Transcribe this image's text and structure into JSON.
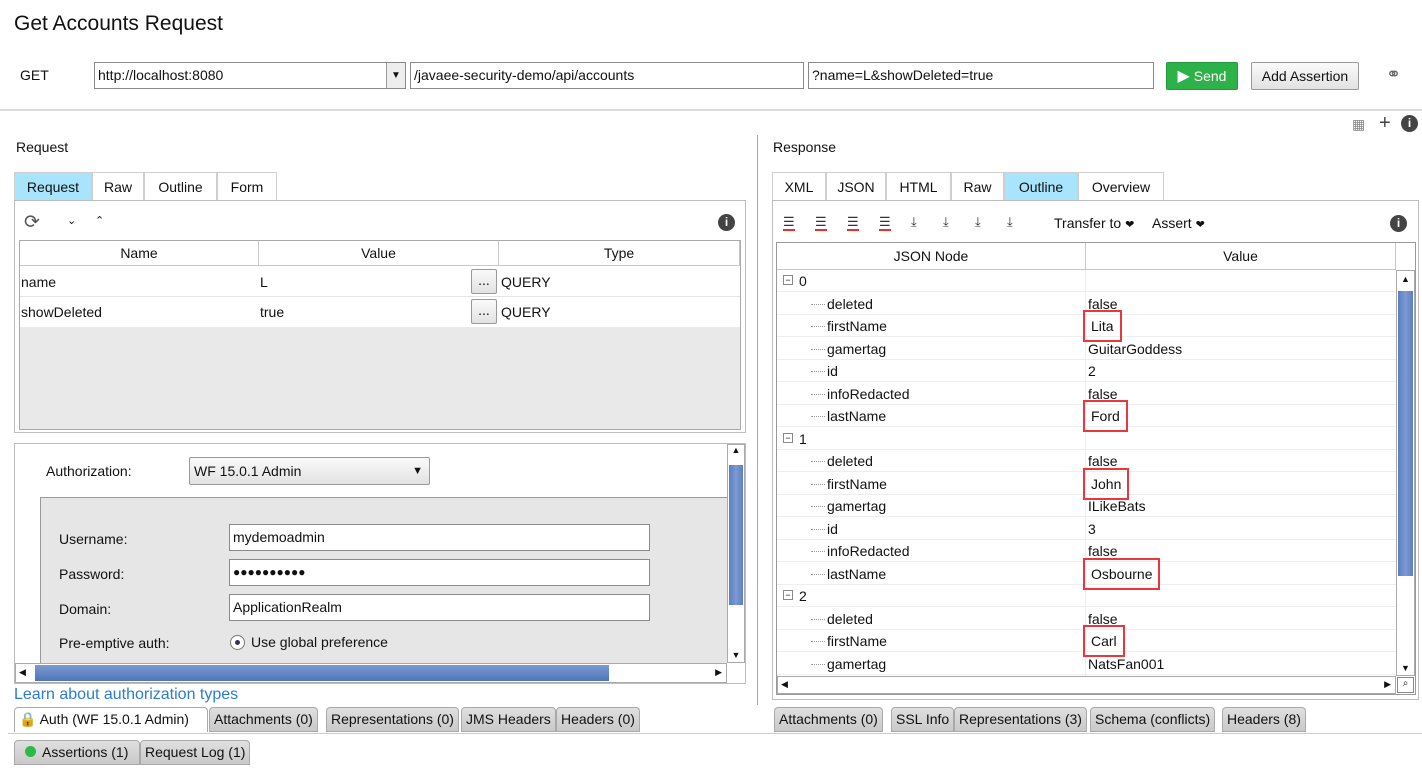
{
  "window": {
    "title": "Get Accounts Request"
  },
  "url_bar": {
    "method": "GET",
    "endpoint": "http://localhost:8080",
    "resource": "/javaee-security-demo/api/accounts",
    "query": "?name=L&showDeleted=true",
    "send_label": "Send",
    "add_assertion_label": "Add Assertion",
    "send_color": "#2db24a"
  },
  "request": {
    "label": "Request",
    "tabs": [
      {
        "label": "Request",
        "active": true
      },
      {
        "label": "Raw"
      },
      {
        "label": "Outline"
      },
      {
        "label": "Form"
      }
    ],
    "columns": [
      "Name",
      "Value",
      "Type"
    ],
    "params": [
      {
        "name": "name",
        "value": "L",
        "type": "QUERY"
      },
      {
        "name": "showDeleted",
        "value": "true",
        "type": "QUERY"
      }
    ],
    "edit_button": "..."
  },
  "auth": {
    "authorization_label": "Authorization:",
    "authorization_value": "WF 15.0.1 Admin",
    "username_label": "Username:",
    "username": "mydemoadmin",
    "password_label": "Password:",
    "password": "●●●●●●●●●●",
    "domain_label": "Domain:",
    "domain": "ApplicationRealm",
    "preemptive_label": "Pre-emptive auth:",
    "preemptive_option": "Use global preference",
    "learn_link": "Learn about authorization types"
  },
  "request_bottom_tabs": [
    "Auth (WF 15.0.1 Admin)",
    "Attachments (0)",
    "Representations (0)",
    "JMS Headers",
    "Headers (0)"
  ],
  "footer_tabs": [
    "Assertions (1)",
    "Request Log (1)"
  ],
  "response": {
    "label": "Response",
    "tabs": [
      {
        "label": "XML"
      },
      {
        "label": "JSON"
      },
      {
        "label": "HTML"
      },
      {
        "label": "Raw"
      },
      {
        "label": "Outline",
        "active": true
      },
      {
        "label": "Overview"
      }
    ],
    "transfer_label": "Transfer to",
    "assert_label": "Assert",
    "columns": [
      "JSON Node",
      "Value"
    ],
    "tree": [
      {
        "index": "0"
      },
      {
        "key": "deleted",
        "value": "false"
      },
      {
        "key": "firstName",
        "value": "Lita",
        "highlighted": true
      },
      {
        "key": "gamertag",
        "value": "GuitarGoddess"
      },
      {
        "key": "id",
        "value": "2"
      },
      {
        "key": "infoRedacted",
        "value": "false"
      },
      {
        "key": "lastName",
        "value": "Ford",
        "highlighted": true
      },
      {
        "index": "1"
      },
      {
        "key": "deleted",
        "value": "false"
      },
      {
        "key": "firstName",
        "value": "John",
        "highlighted": true
      },
      {
        "key": "gamertag",
        "value": "ILikeBats"
      },
      {
        "key": "id",
        "value": "3"
      },
      {
        "key": "infoRedacted",
        "value": "false"
      },
      {
        "key": "lastName",
        "value": "Osbourne",
        "highlighted": true
      },
      {
        "index": "2"
      },
      {
        "key": "deleted",
        "value": "false"
      },
      {
        "key": "firstName",
        "value": "Carl",
        "highlighted": true
      },
      {
        "key": "gamertag",
        "value": "NatsFan001"
      }
    ],
    "highlight_color": "#e8383d",
    "bottom_tabs": [
      "Attachments (0)",
      "SSL Info",
      "Representations (3)",
      "Schema (conflicts)",
      "Headers (8)"
    ]
  },
  "colors": {
    "active_tab": "#a8e4fb",
    "scroll_thumb": "#5b7fc0",
    "assertion_status": "#2fb84a"
  }
}
